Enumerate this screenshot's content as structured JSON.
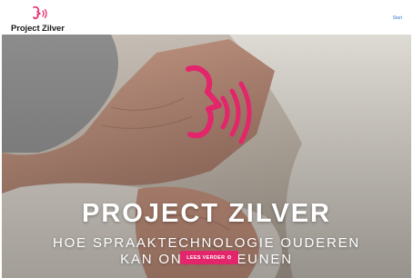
{
  "header": {
    "logo_text": "Project Zilver",
    "nav_link": "Start"
  },
  "hero": {
    "title": "PROJECT ZILVER",
    "subtitle_line1": "HOE SPRAAKTECHNOLOGIE OUDEREN",
    "subtitle_line2": "KAN ONDERSTEUNEN",
    "cta_label": "LEES VERDER",
    "cta_icon": "⊙"
  },
  "colors": {
    "accent": "#e3256b",
    "link": "#3a7bd5"
  },
  "icons": {
    "logo": "talking-face-icon",
    "hero_mark": "talking-face-sound-waves-icon",
    "cta": "circle-arrow-icon"
  }
}
